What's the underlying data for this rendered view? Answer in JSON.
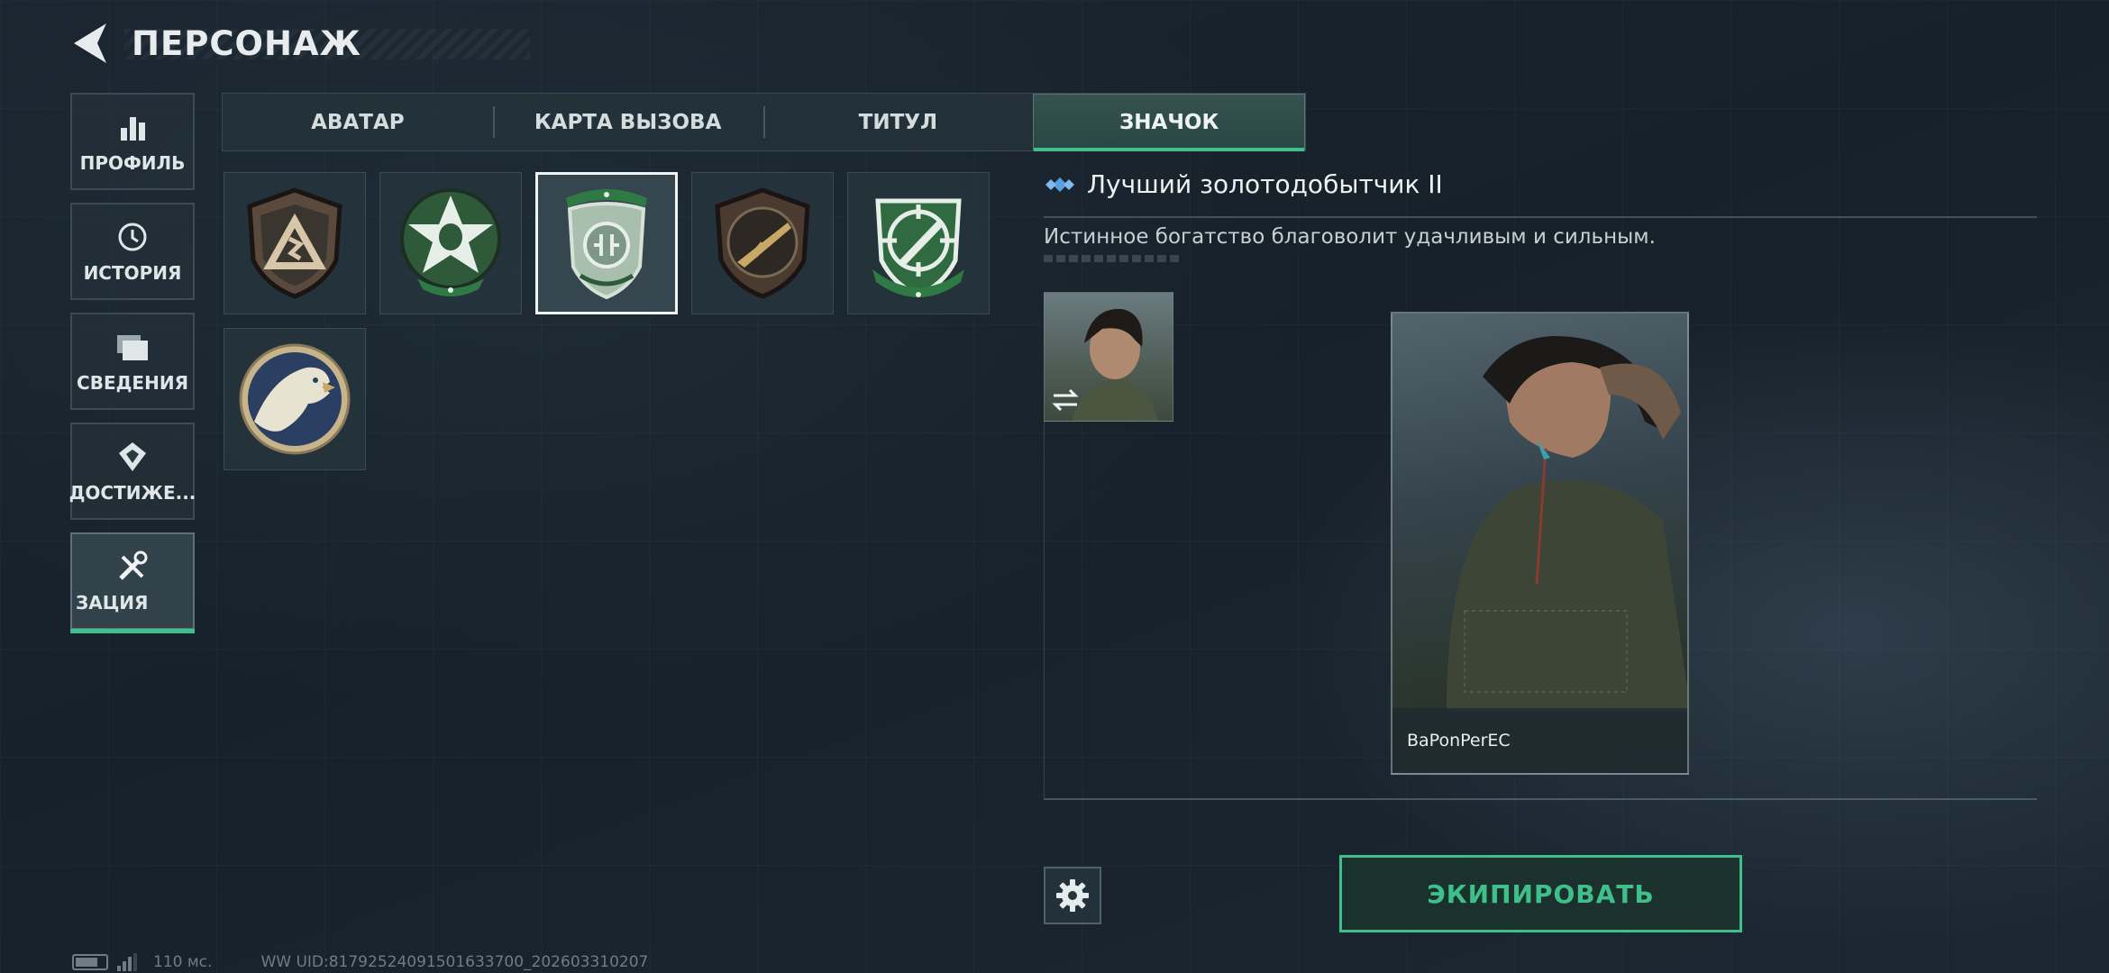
{
  "header": {
    "title": "ПЕРСОНАЖ"
  },
  "sidebar": {
    "items": [
      {
        "label": "ПРОФИЛЬ",
        "icon": "bar-chart-icon"
      },
      {
        "label": "ИСТОРИЯ",
        "icon": "history-clock-icon"
      },
      {
        "label": "СВЕДЕНИЯ",
        "icon": "folder-icon"
      },
      {
        "label": "ДОСТИЖЕ...",
        "icon": "achievement-icon"
      },
      {
        "label": "ЗАЦИЯ",
        "icon": "wrench-screwdriver-icon",
        "active": true
      }
    ]
  },
  "tabs": [
    {
      "label": "АВАТАР"
    },
    {
      "label": "КАРТА ВЫЗОВА"
    },
    {
      "label": "ТИТУЛ"
    },
    {
      "label": "ЗНАЧОК",
      "active": true
    }
  ],
  "badges": [
    {
      "name": "triangle-shield-badge"
    },
    {
      "name": "star-skull-badge"
    },
    {
      "name": "crest-shield-badge",
      "selected": true
    },
    {
      "name": "rifle-badge"
    },
    {
      "name": "crosshair-knife-badge"
    },
    {
      "name": "eagle-badge"
    }
  ],
  "detail": {
    "title": "Лучший золотодобытчик II",
    "description": "Истинное богатство благоволит удачливым и сильным."
  },
  "preview": {
    "player_name": "BaPonPerEC"
  },
  "actions": {
    "equip_label": "ЭКИПИРОВАТЬ"
  },
  "footer": {
    "ping": "110 мс.",
    "uid": "WW UID:81792524091501633700_202603310207"
  },
  "colors": {
    "accent": "#3fc08a",
    "background": "#1a2530"
  }
}
